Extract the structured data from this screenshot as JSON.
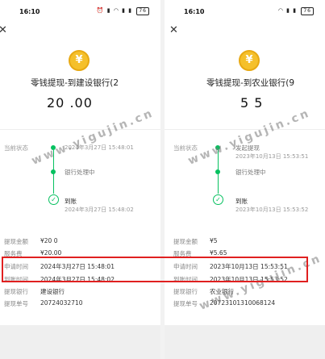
{
  "left": {
    "time": "16:10",
    "battery": "76",
    "title": "零钱提现-到建设银行(2",
    "amount": "20  .00",
    "status_label": "当前状态",
    "steps": [
      {
        "title": "",
        "time": "2024年3月27日 15:48:01"
      },
      {
        "title": "银行处理中",
        "time": ""
      },
      {
        "title": "到账",
        "time": "2024年3月27日 15:48:02"
      }
    ],
    "details": [
      {
        "label": "提现金额",
        "value": "¥20  0"
      },
      {
        "label": "服务费",
        "value": "¥20.00"
      },
      {
        "label": "申请时间",
        "value": "2024年3月27日 15:48:01"
      },
      {
        "label": "到账时间",
        "value": "2024年3月27日 15:48:02"
      },
      {
        "label": "提现银行",
        "value": "建设银行"
      },
      {
        "label": "提现单号",
        "value": "20724032710 "
      }
    ]
  },
  "right": {
    "time": "16:10",
    "battery": "76",
    "title": "零钱提现-到农业银行(9",
    "amount": "5     5",
    "status_label": "当前状态",
    "steps": [
      {
        "title": "发起提现",
        "time": "2023年10月13日 15:53:51"
      },
      {
        "title": "银行处理中",
        "time": ""
      },
      {
        "title": "到账",
        "time": "2023年10月13日 15:53:52"
      }
    ],
    "details": [
      {
        "label": "提现金额",
        "value": "¥5    "
      },
      {
        "label": "服务费",
        "value": "¥5.65"
      },
      {
        "label": "申请时间",
        "value": "2023年10月13日 15:53:51"
      },
      {
        "label": "到账时间",
        "value": "2023年10月13日 15:53:52"
      },
      {
        "label": "提现银行",
        "value": "农业银行"
      },
      {
        "label": "提现单号",
        "value": "20723101310068124"
      }
    ]
  },
  "icons": {
    "close": "close-icon",
    "coin": "yuan-coin-icon",
    "check": "check-circle-icon"
  },
  "watermark": "www.yigujin.cn",
  "colors": {
    "accent": "#07c160",
    "coin": "#f5c02b",
    "highlight": "#e02020"
  }
}
